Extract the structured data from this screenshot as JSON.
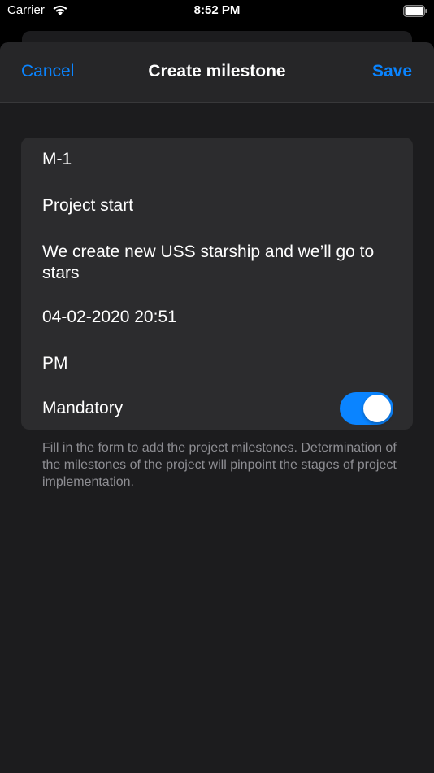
{
  "status_bar": {
    "carrier": "Carrier",
    "time": "8:52 PM"
  },
  "nav": {
    "cancel_label": "Cancel",
    "title": "Create milestone",
    "save_label": "Save"
  },
  "form": {
    "code": "M-1",
    "name": "Project start",
    "description": "We create new USS starship and we’ll go to stars",
    "date": "04-02-2020 20:51",
    "responsible": "PM",
    "mandatory_label": "Mandatory",
    "mandatory_on": true
  },
  "footer_note": "Fill in the form to add the project milestones. Determination of the milestones of the project will pinpoint the stages of project implementation.",
  "colors": {
    "accent": "#0a84ff",
    "background": "#1c1c1e",
    "card": "#2c2c2e",
    "secondary_text": "#8e8e93"
  }
}
